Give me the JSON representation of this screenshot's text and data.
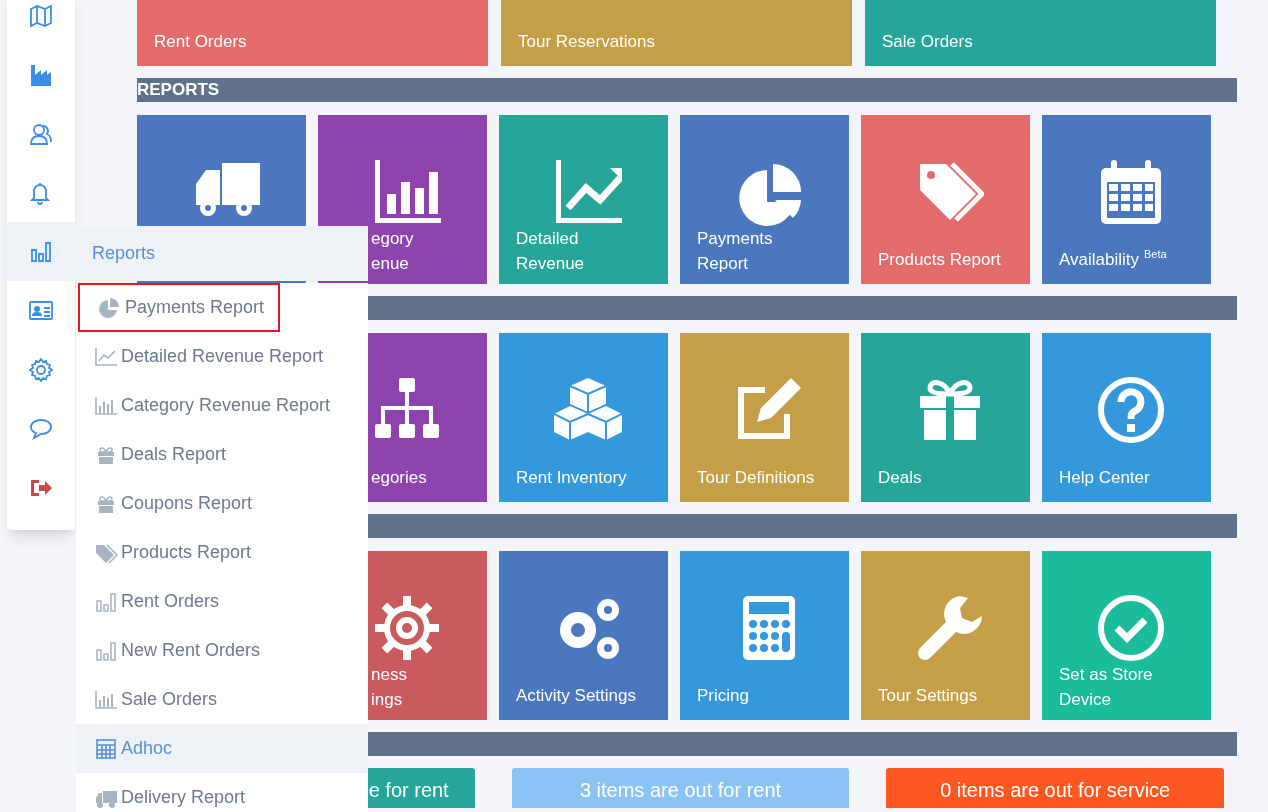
{
  "top_tiles": [
    {
      "label": "Rent Orders",
      "color": "#e46b6b"
    },
    {
      "label": "Tour Reservations",
      "color": "#c49f47"
    },
    {
      "label": "Sale Orders",
      "color": "#26a69a"
    }
  ],
  "sections": [
    {
      "title": "REPORTS",
      "tiles": [
        {
          "color": "#4a77bd"
        },
        {
          "covered": true,
          "lines": [
            "egory",
            "enue"
          ],
          "color": "#8e44ad"
        },
        {
          "covered": false,
          "lines": [
            "Detailed",
            "Revenue"
          ],
          "color": "#26a69a"
        },
        {
          "covered": false,
          "lines": [
            "Payments",
            "Report"
          ],
          "color": "#4a77bd"
        },
        {
          "covered": false,
          "lines": [
            "Products Report"
          ],
          "color": "#e46b6b"
        },
        {
          "covered": false,
          "lines": [
            "Availability"
          ],
          "sup": "Beta",
          "color": "#4a77bd"
        }
      ]
    },
    {
      "tiles": [
        {
          "covered": true,
          "lines": [
            "egories"
          ],
          "color": "#8e44ad"
        },
        {
          "covered": false,
          "lines": [
            "Rent Inventory"
          ],
          "color": "#3598dc"
        },
        {
          "covered": false,
          "lines": [
            "Tour Definitions"
          ],
          "color": "#c49f47"
        },
        {
          "covered": false,
          "lines": [
            "Deals"
          ],
          "color": "#26a69a"
        },
        {
          "covered": false,
          "lines": [
            "Help Center"
          ],
          "color": "#3598dc"
        }
      ]
    },
    {
      "tiles": [
        {
          "covered": true,
          "lines": [
            "ness",
            "ings"
          ],
          "color": "#c95b5e"
        },
        {
          "covered": false,
          "lines": [
            "Activity Settings"
          ],
          "color": "#4a77bd"
        },
        {
          "covered": false,
          "lines": [
            "Pricing"
          ],
          "color": "#3598dc"
        },
        {
          "covered": false,
          "lines": [
            "Tour Settings"
          ],
          "color": "#c49f47"
        },
        {
          "covered": false,
          "lines": [
            "Set as Store",
            "Device"
          ],
          "color": "#1abc9c"
        }
      ]
    }
  ],
  "status_cards": [
    {
      "text": "e for rent",
      "color": "#26a69a"
    },
    {
      "text": "3 items are out for rent",
      "color": "#89c4f4"
    },
    {
      "text": "0 items are out for service",
      "color": "#ff5722"
    }
  ],
  "sidebar": {
    "items": [
      {
        "selected": false
      },
      {
        "selected": false
      },
      {
        "selected": false
      },
      {
        "selected": false
      },
      {
        "selected": true
      },
      {
        "selected": false
      },
      {
        "selected": false
      },
      {
        "selected": false
      },
      {
        "selected": false
      }
    ]
  },
  "flyout": {
    "title": "Reports",
    "items": [
      {
        "label": "Payments Report",
        "selected": false,
        "highlighted": true
      },
      {
        "label": "Detailed Revenue Report",
        "selected": false,
        "highlighted": false
      },
      {
        "label": "Category Revenue Report",
        "selected": false,
        "highlighted": false
      },
      {
        "label": "Deals Report",
        "selected": false,
        "highlighted": false
      },
      {
        "label": "Coupons Report",
        "selected": false,
        "highlighted": false
      },
      {
        "label": "Products Report",
        "selected": false,
        "highlighted": false
      },
      {
        "label": "Rent Orders",
        "selected": false,
        "highlighted": false
      },
      {
        "label": "New Rent Orders",
        "selected": false,
        "highlighted": false
      },
      {
        "label": "Sale Orders",
        "selected": false,
        "highlighted": false
      },
      {
        "label": "Adhoc",
        "selected": true,
        "highlighted": false
      },
      {
        "label": "Delivery Report",
        "selected": false,
        "highlighted": false
      }
    ]
  }
}
